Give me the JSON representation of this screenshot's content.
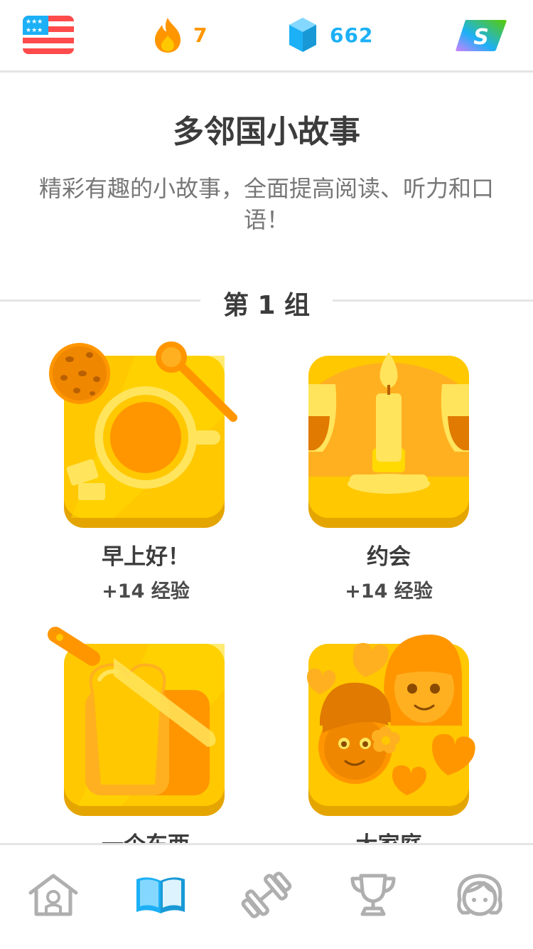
{
  "topbar": {
    "course_flag": "us-flag-icon",
    "streak_count": "7",
    "gem_count": "662",
    "plus_badge": "S"
  },
  "header": {
    "title": "多邻国小故事",
    "subtitle": "精彩有趣的小故事，全面提高阅读、听力和口语！"
  },
  "group": {
    "label": "第 1 组"
  },
  "stories": [
    {
      "title": "早上好！",
      "xp": "+14 经验",
      "icon": "coffee-cookie-icon"
    },
    {
      "title": "约会",
      "xp": "+14 经验",
      "icon": "candle-wine-icon"
    },
    {
      "title": "一个东西",
      "xp": "",
      "icon": "bread-knife-icon"
    },
    {
      "title": "大家庭",
      "xp": "",
      "icon": "family-hearts-icon"
    }
  ],
  "nav": {
    "items": [
      "home-icon",
      "stories-book-icon",
      "dumbbell-icon",
      "trophy-icon",
      "profile-avatar-icon"
    ],
    "active_index": 1
  },
  "colors": {
    "streak": "#ff9600",
    "gems": "#1cb0f6",
    "card_yellow": "#ffc800",
    "active_tab": "#1cb0f6",
    "inactive_tab": "#afafaf"
  }
}
